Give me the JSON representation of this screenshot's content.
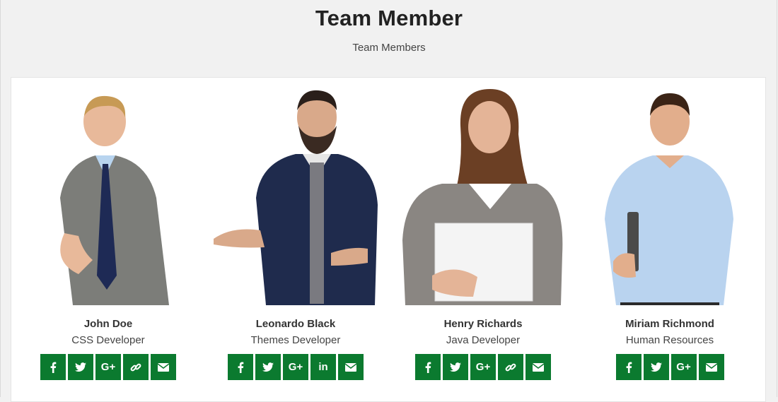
{
  "header": {
    "title": "Team Member",
    "subtitle": "Team Members"
  },
  "colors": {
    "accent": "#0b7a2f",
    "background": "#f1f1f1",
    "panel": "#ffffff"
  },
  "members": [
    {
      "name": "John Doe",
      "role": "CSS Developer",
      "socials": [
        "facebook-icon",
        "twitter-icon",
        "google-plus-icon",
        "link-icon",
        "envelope-icon"
      ],
      "google_label": "G+"
    },
    {
      "name": "Leonardo Black",
      "role": "Themes Developer",
      "socials": [
        "facebook-icon",
        "twitter-icon",
        "google-plus-icon",
        "linkedin-icon",
        "envelope-icon"
      ],
      "google_label": "G+",
      "linkedin_label": "in"
    },
    {
      "name": "Henry Richards",
      "role": "Java Developer",
      "socials": [
        "facebook-icon",
        "twitter-icon",
        "google-plus-icon",
        "link-icon",
        "envelope-icon"
      ],
      "google_label": "G+"
    },
    {
      "name": "Miriam Richmond",
      "role": "Human Resources",
      "socials": [
        "facebook-icon",
        "twitter-icon",
        "google-plus-icon",
        "envelope-icon"
      ],
      "google_label": "G+"
    }
  ]
}
